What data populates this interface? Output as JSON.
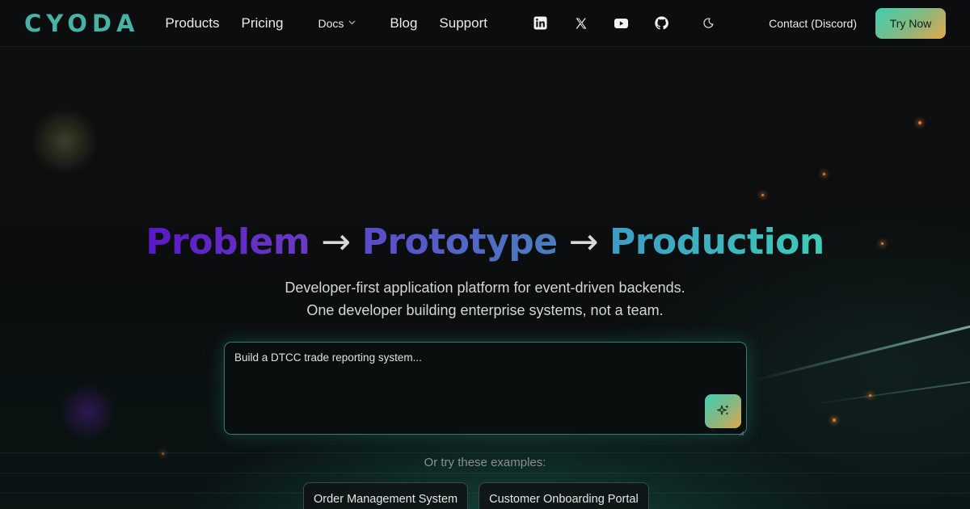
{
  "nav": {
    "logo": "CYODA",
    "links": [
      "Products",
      "Pricing"
    ],
    "docs_label": "Docs",
    "links_after": [
      "Blog",
      "Support"
    ],
    "social_icons": [
      "linkedin-icon",
      "x-icon",
      "youtube-icon",
      "github-icon"
    ],
    "theme_icon": "moon-icon",
    "contact_label": "Contact (Discord)",
    "cta_label": "Try Now"
  },
  "hero": {
    "title_parts": [
      "Problem",
      "→",
      "Prototype",
      "→",
      "Production"
    ],
    "subtitle_line1": "Developer-first application platform for event-driven backends.",
    "subtitle_line2": "One developer building enterprise systems, not a team.",
    "prompt_placeholder": "Build a DTCC trade reporting system...",
    "send_icon": "sparkle-icon",
    "examples_label": "Or try these examples:",
    "examples": [
      "Order Management System",
      "Customer Onboarding Portal"
    ]
  },
  "colors": {
    "accent_teal": "#47b3a6",
    "gradient_purple": "#5a18c8",
    "gradient_blue": "#4a7fc0",
    "gradient_cyan": "#3ecbb6",
    "cta_gradient_end": "#e2a84a",
    "background": "#0b0d0e"
  }
}
